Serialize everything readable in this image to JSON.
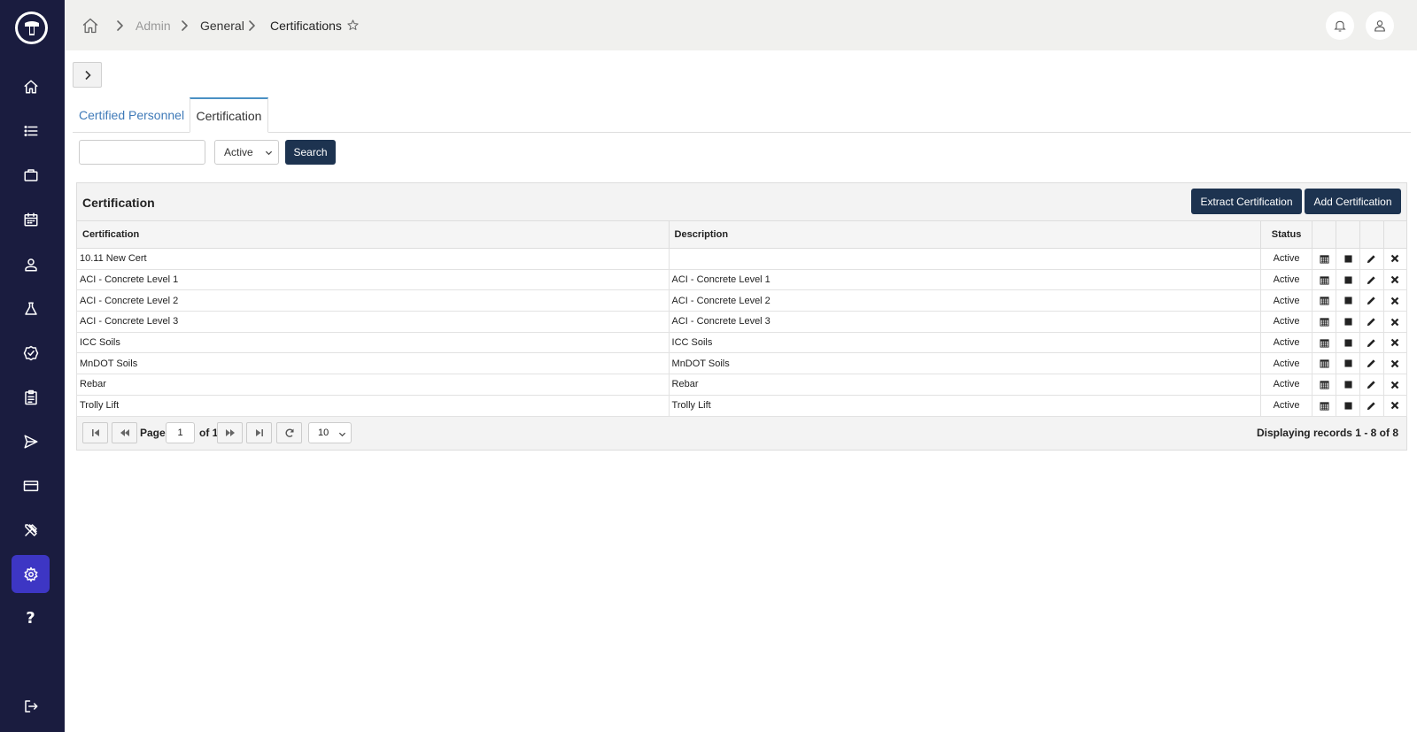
{
  "sidebar": {
    "logo": "app-logo",
    "items": [
      {
        "name": "home",
        "icon": "home-icon"
      },
      {
        "name": "list",
        "icon": "list-icon"
      },
      {
        "name": "projects",
        "icon": "briefcase-icon"
      },
      {
        "name": "calendar",
        "icon": "calendar-icon"
      },
      {
        "name": "personnel",
        "icon": "person-icon"
      },
      {
        "name": "lab",
        "icon": "flask-icon"
      },
      {
        "name": "approvals",
        "icon": "badge-check-icon"
      },
      {
        "name": "reports",
        "icon": "clipboard-icon"
      },
      {
        "name": "send",
        "icon": "send-icon"
      },
      {
        "name": "billing",
        "icon": "credit-card-icon"
      },
      {
        "name": "tools",
        "icon": "tools-icon"
      },
      {
        "name": "settings",
        "icon": "gear-icon",
        "active": true
      },
      {
        "name": "help",
        "icon": "question-icon",
        "glyph": "?"
      },
      {
        "name": "logout",
        "icon": "logout-icon"
      }
    ],
    "accent": "#3d36c4",
    "background": "#1a1c3f"
  },
  "breadcrumb": {
    "items": [
      "Admin",
      "General",
      "Certifications"
    ]
  },
  "tabs": [
    {
      "label": "Certified Personnel",
      "active": false
    },
    {
      "label": "Certification",
      "active": true
    }
  ],
  "filters": {
    "search_value": "",
    "status_selected": "Active",
    "search_button": "Search"
  },
  "panel": {
    "title": "Certification",
    "extract_button": "Extract Certification",
    "add_button": "Add Certification"
  },
  "table": {
    "columns": [
      "Certification",
      "Description",
      "Status"
    ],
    "rows": [
      {
        "certification": "10.11 New Cert",
        "description": "",
        "status": "Active"
      },
      {
        "certification": "ACI - Concrete Level 1",
        "description": "ACI - Concrete Level 1",
        "status": "Active"
      },
      {
        "certification": "ACI - Concrete Level 2",
        "description": "ACI - Concrete Level 2",
        "status": "Active"
      },
      {
        "certification": "ACI - Concrete Level 3",
        "description": "ACI - Concrete Level 3",
        "status": "Active"
      },
      {
        "certification": "ICC Soils",
        "description": "ICC Soils",
        "status": "Active"
      },
      {
        "certification": "MnDOT Soils",
        "description": "MnDOT Soils",
        "status": "Active"
      },
      {
        "certification": "Rebar",
        "description": "Rebar",
        "status": "Active"
      },
      {
        "certification": "Trolly Lift",
        "description": "Trolly Lift",
        "status": "Active"
      }
    ],
    "row_actions": [
      "calendar-icon",
      "stop-icon",
      "pencil-icon",
      "close-icon"
    ]
  },
  "pager": {
    "page_label": "Page",
    "page_value": "1",
    "of_label": "of 1",
    "page_size": "10",
    "records_text": "Displaying records  1 - 8  of  8"
  }
}
